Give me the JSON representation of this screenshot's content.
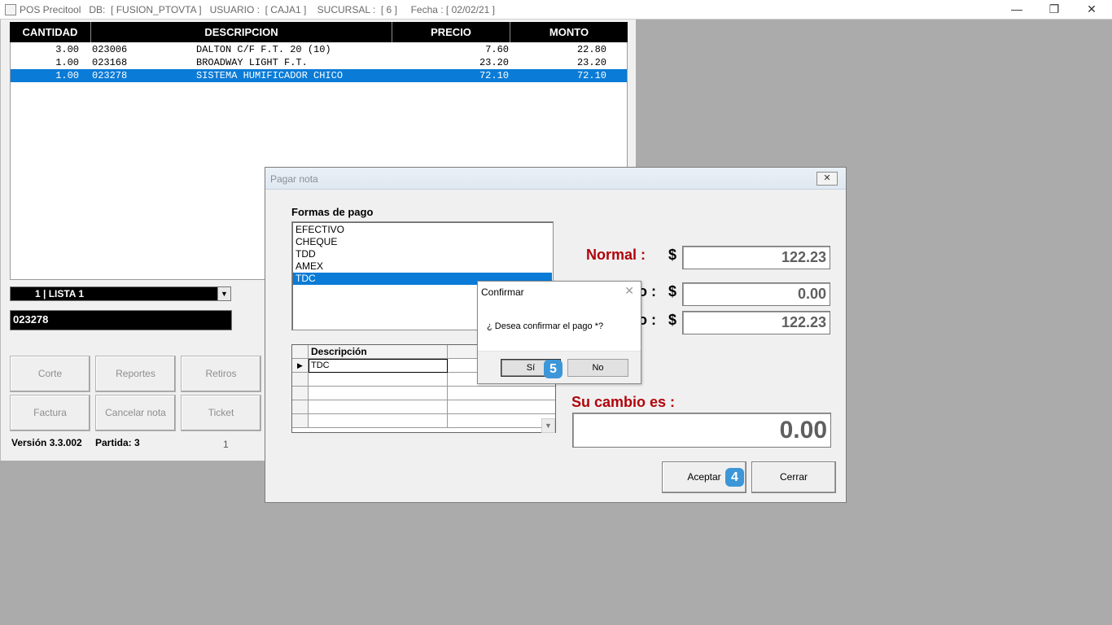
{
  "titlebar": {
    "text": "POS Precitool   DB:  [ FUSION_PTOVTA ]   USUARIO :  [ CAJA1 ]    SUCURSAL :  [ 6 ]     Fecha : [ 02/02/21 ]",
    "minimize": "—",
    "restore": "❐",
    "close": "✕"
  },
  "sale_grid": {
    "headers": [
      "CANTIDAD",
      "DESCRIPCION",
      "PRECIO",
      "MONTO"
    ],
    "rows": [
      {
        "qty": "3.00",
        "code": "023006",
        "desc": "DALTON C/F F.T. 20 (10)",
        "precio": "7.60",
        "monto": "22.80"
      },
      {
        "qty": "1.00",
        "code": "023168",
        "desc": "BROADWAY LIGHT F.T.",
        "precio": "23.20",
        "monto": "23.20"
      },
      {
        "qty": "1.00",
        "code": "023278",
        "desc": "SISTEMA HUMIFICADOR CHICO",
        "precio": "72.10",
        "monto": "72.10"
      }
    ]
  },
  "lista_combo": {
    "value": "1  | LISTA 1",
    "arrow": "▼"
  },
  "code_input": {
    "value": "023278"
  },
  "buttons": {
    "corte": "Corte",
    "reportes": "Reportes",
    "retiros": "Retiros",
    "factura": "Factura",
    "cancelar": "Cancelar nota",
    "ticket": "Ticket"
  },
  "status": {
    "version": "Versión 3.3.002",
    "partida": "Partida: 3",
    "page": "1"
  },
  "pagar_nota": {
    "title": "Pagar nota",
    "close": "✕",
    "formas_label": "Formas de pago",
    "formas": [
      "EFECTIVO",
      "CHEQUE",
      "TDD",
      "AMEX",
      "TDC"
    ],
    "grid_header": "Descripción",
    "grid_row_marker": "▶",
    "grid_row_value": "TDC",
    "scroll_arrow": "▼",
    "normal_label": "Normal :",
    "label2_tail": "o :",
    "label3_tail": "o :",
    "currency": "$",
    "normal_amount": "122.23",
    "amount2": "0.00",
    "amount3": "122.23",
    "cambio_label": "Su cambio es :",
    "cambio_amount": "0.00",
    "aceptar": "Aceptar",
    "cerrar": "Cerrar",
    "badge_aceptar": "4"
  },
  "confirmar": {
    "title": "Confirmar",
    "close": "✕",
    "message": "¿ Desea confirmar el pago *?",
    "si": "Sí",
    "no": "No",
    "badge_si": "5"
  },
  "colors": {
    "accent_red": "#b0040b",
    "selection_blue": "#0a7bd7",
    "badge_blue": "#3c96d8"
  }
}
